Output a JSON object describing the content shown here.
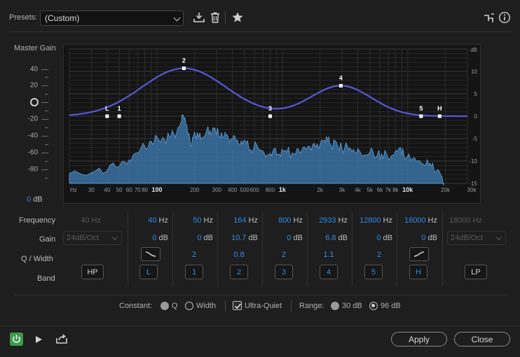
{
  "header": {
    "presets_label": "Presets:",
    "preset_value": "(Custom)"
  },
  "master_gain": {
    "title": "Master Gain",
    "scale": [
      "40",
      "20",
      "0",
      "-20",
      "-40",
      "-60",
      "-80"
    ],
    "value": "0",
    "unit": "dB"
  },
  "graph": {
    "db_axis_label": "dB",
    "db_ticks": [
      "10",
      "5",
      "0",
      "-5",
      "-10",
      "-15"
    ],
    "freq_ticks": [
      "Hz",
      "30",
      "40",
      "50",
      "60",
      "70",
      "80",
      "100",
      "200",
      "300",
      "400",
      "500",
      "600",
      "800",
      "1k",
      "2k",
      "3k",
      "4k",
      "5k",
      "6k",
      "7k",
      "8k",
      "10k",
      "20k",
      "30k"
    ],
    "markers": [
      "L",
      "1",
      "2",
      "3",
      "4",
      "5",
      "H"
    ],
    "colors": {
      "curve": "#5858d8",
      "spectrum": "#3f7fb5",
      "marker": "#ffffff"
    }
  },
  "row_labels": {
    "frequency": "Frequency",
    "gain": "Gain",
    "q_width": "Q / Width",
    "band": "Band"
  },
  "bands": {
    "hp": {
      "freq": "40",
      "unit": "Hz",
      "slope": "24dB/Oct",
      "label": "HP"
    },
    "l": {
      "freq": "40",
      "unit": "Hz",
      "gain": "0",
      "gain_unit": "dB",
      "label": "L"
    },
    "b1": {
      "freq": "50",
      "unit": "Hz",
      "gain": "0",
      "gain_unit": "dB",
      "q": "2",
      "label": "1"
    },
    "b2": {
      "freq": "164",
      "unit": "Hz",
      "gain": "10.7",
      "gain_unit": "dB",
      "q": "0.8",
      "label": "2"
    },
    "b3": {
      "freq": "800",
      "unit": "Hz",
      "gain": "0",
      "gain_unit": "dB",
      "q": "2",
      "label": "3"
    },
    "b4": {
      "freq": "2933",
      "unit": "Hz",
      "gain": "6.8",
      "gain_unit": "dB",
      "q": "1.1",
      "label": "4"
    },
    "b5": {
      "freq": "12800",
      "unit": "Hz",
      "gain": "0",
      "gain_unit": "dB",
      "q": "2",
      "label": "5"
    },
    "h": {
      "freq": "18000",
      "unit": "Hz",
      "gain": "0",
      "gain_unit": "dB",
      "label": "H"
    },
    "lp": {
      "freq": "18000",
      "unit": "Hz",
      "slope": "24dB/Oct",
      "label": "LP"
    }
  },
  "constant": {
    "label": "Constant:",
    "q": "Q",
    "width": "Width",
    "ultra_quiet": "Ultra-Quiet",
    "range_label": "Range:",
    "range_30": "30 dB",
    "range_96": "96 dB"
  },
  "footer": {
    "apply": "Apply",
    "close": "Close"
  }
}
